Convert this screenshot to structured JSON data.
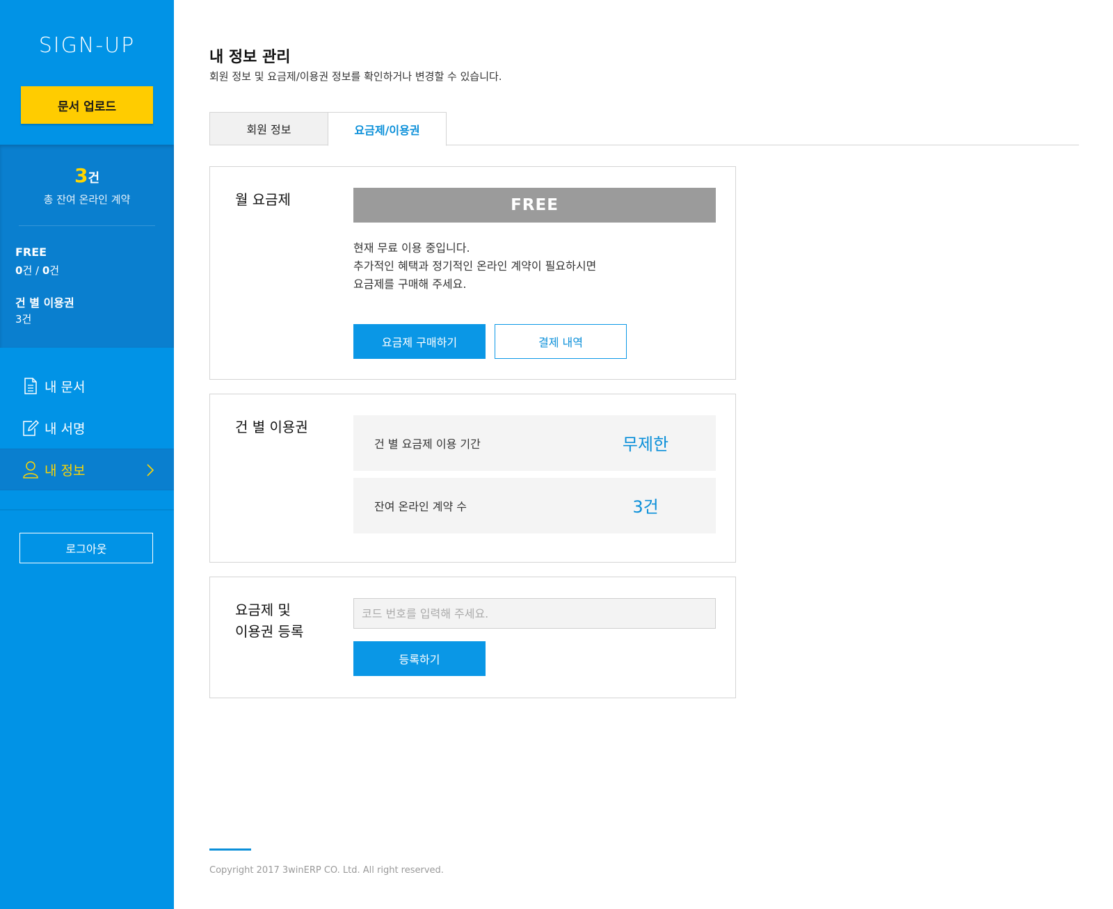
{
  "sidebar": {
    "logo": "SIGN-UP",
    "upload_label": "문서 업로드",
    "stats": {
      "count": "3",
      "count_unit": "건",
      "count_label": "총 잔여 온라인 계약",
      "plan_name": "FREE",
      "plan_used": "0",
      "plan_used_unit": "건",
      "plan_sep": " / ",
      "plan_total": "0",
      "plan_total_unit": "건",
      "ticket_name": "건 별 이용권",
      "ticket_count": "3건"
    },
    "nav": [
      {
        "label": "내 문서",
        "icon": "document-icon"
      },
      {
        "label": "내 서명",
        "icon": "sign-edit-icon"
      },
      {
        "label": "내 정보",
        "icon": "user-icon",
        "active": true
      }
    ],
    "logout_label": "로그아웃"
  },
  "header": {
    "title": "내 정보 관리",
    "description": "회원 정보 및 요금제/이용권 정보를 확인하거나 변경할 수 있습니다."
  },
  "tabs": [
    {
      "label": "회원 정보",
      "active": false
    },
    {
      "label": "요금제/이용권",
      "active": true
    }
  ],
  "plan_card": {
    "title": "월 요금제",
    "plan_badge": "FREE",
    "message_lines": [
      "현재 무료 이용 중입니다.",
      "추가적인 혜택과 정기적인 온라인 계약이 필요하시면",
      "요금제를 구매해 주세요."
    ],
    "buy_label": "요금제 구매하기",
    "history_label": "결제 내역"
  },
  "ticket_card": {
    "title": "건 별 이용권",
    "rows": [
      {
        "label": "건 별 요금제 이용 기간",
        "value": "무제한"
      },
      {
        "label": "잔여 온라인 계약 수",
        "value": "3건"
      }
    ]
  },
  "register_card": {
    "title_line1": "요금제 및",
    "title_line2": "이용권 등록",
    "input_placeholder": "코드 번호를 입력해 주세요.",
    "input_value": "",
    "register_label": "등록하기"
  },
  "footer": {
    "copyright": "Copyright 2017 3winERP CO. Ltd. All right reserved."
  },
  "colors": {
    "sidebar_bg": "#0193e6",
    "sidebar_dark": "#0a7fcf",
    "accent_yellow": "#ffcc00",
    "primary_blue": "#0a97e6",
    "free_gray": "#9b9b9b"
  }
}
